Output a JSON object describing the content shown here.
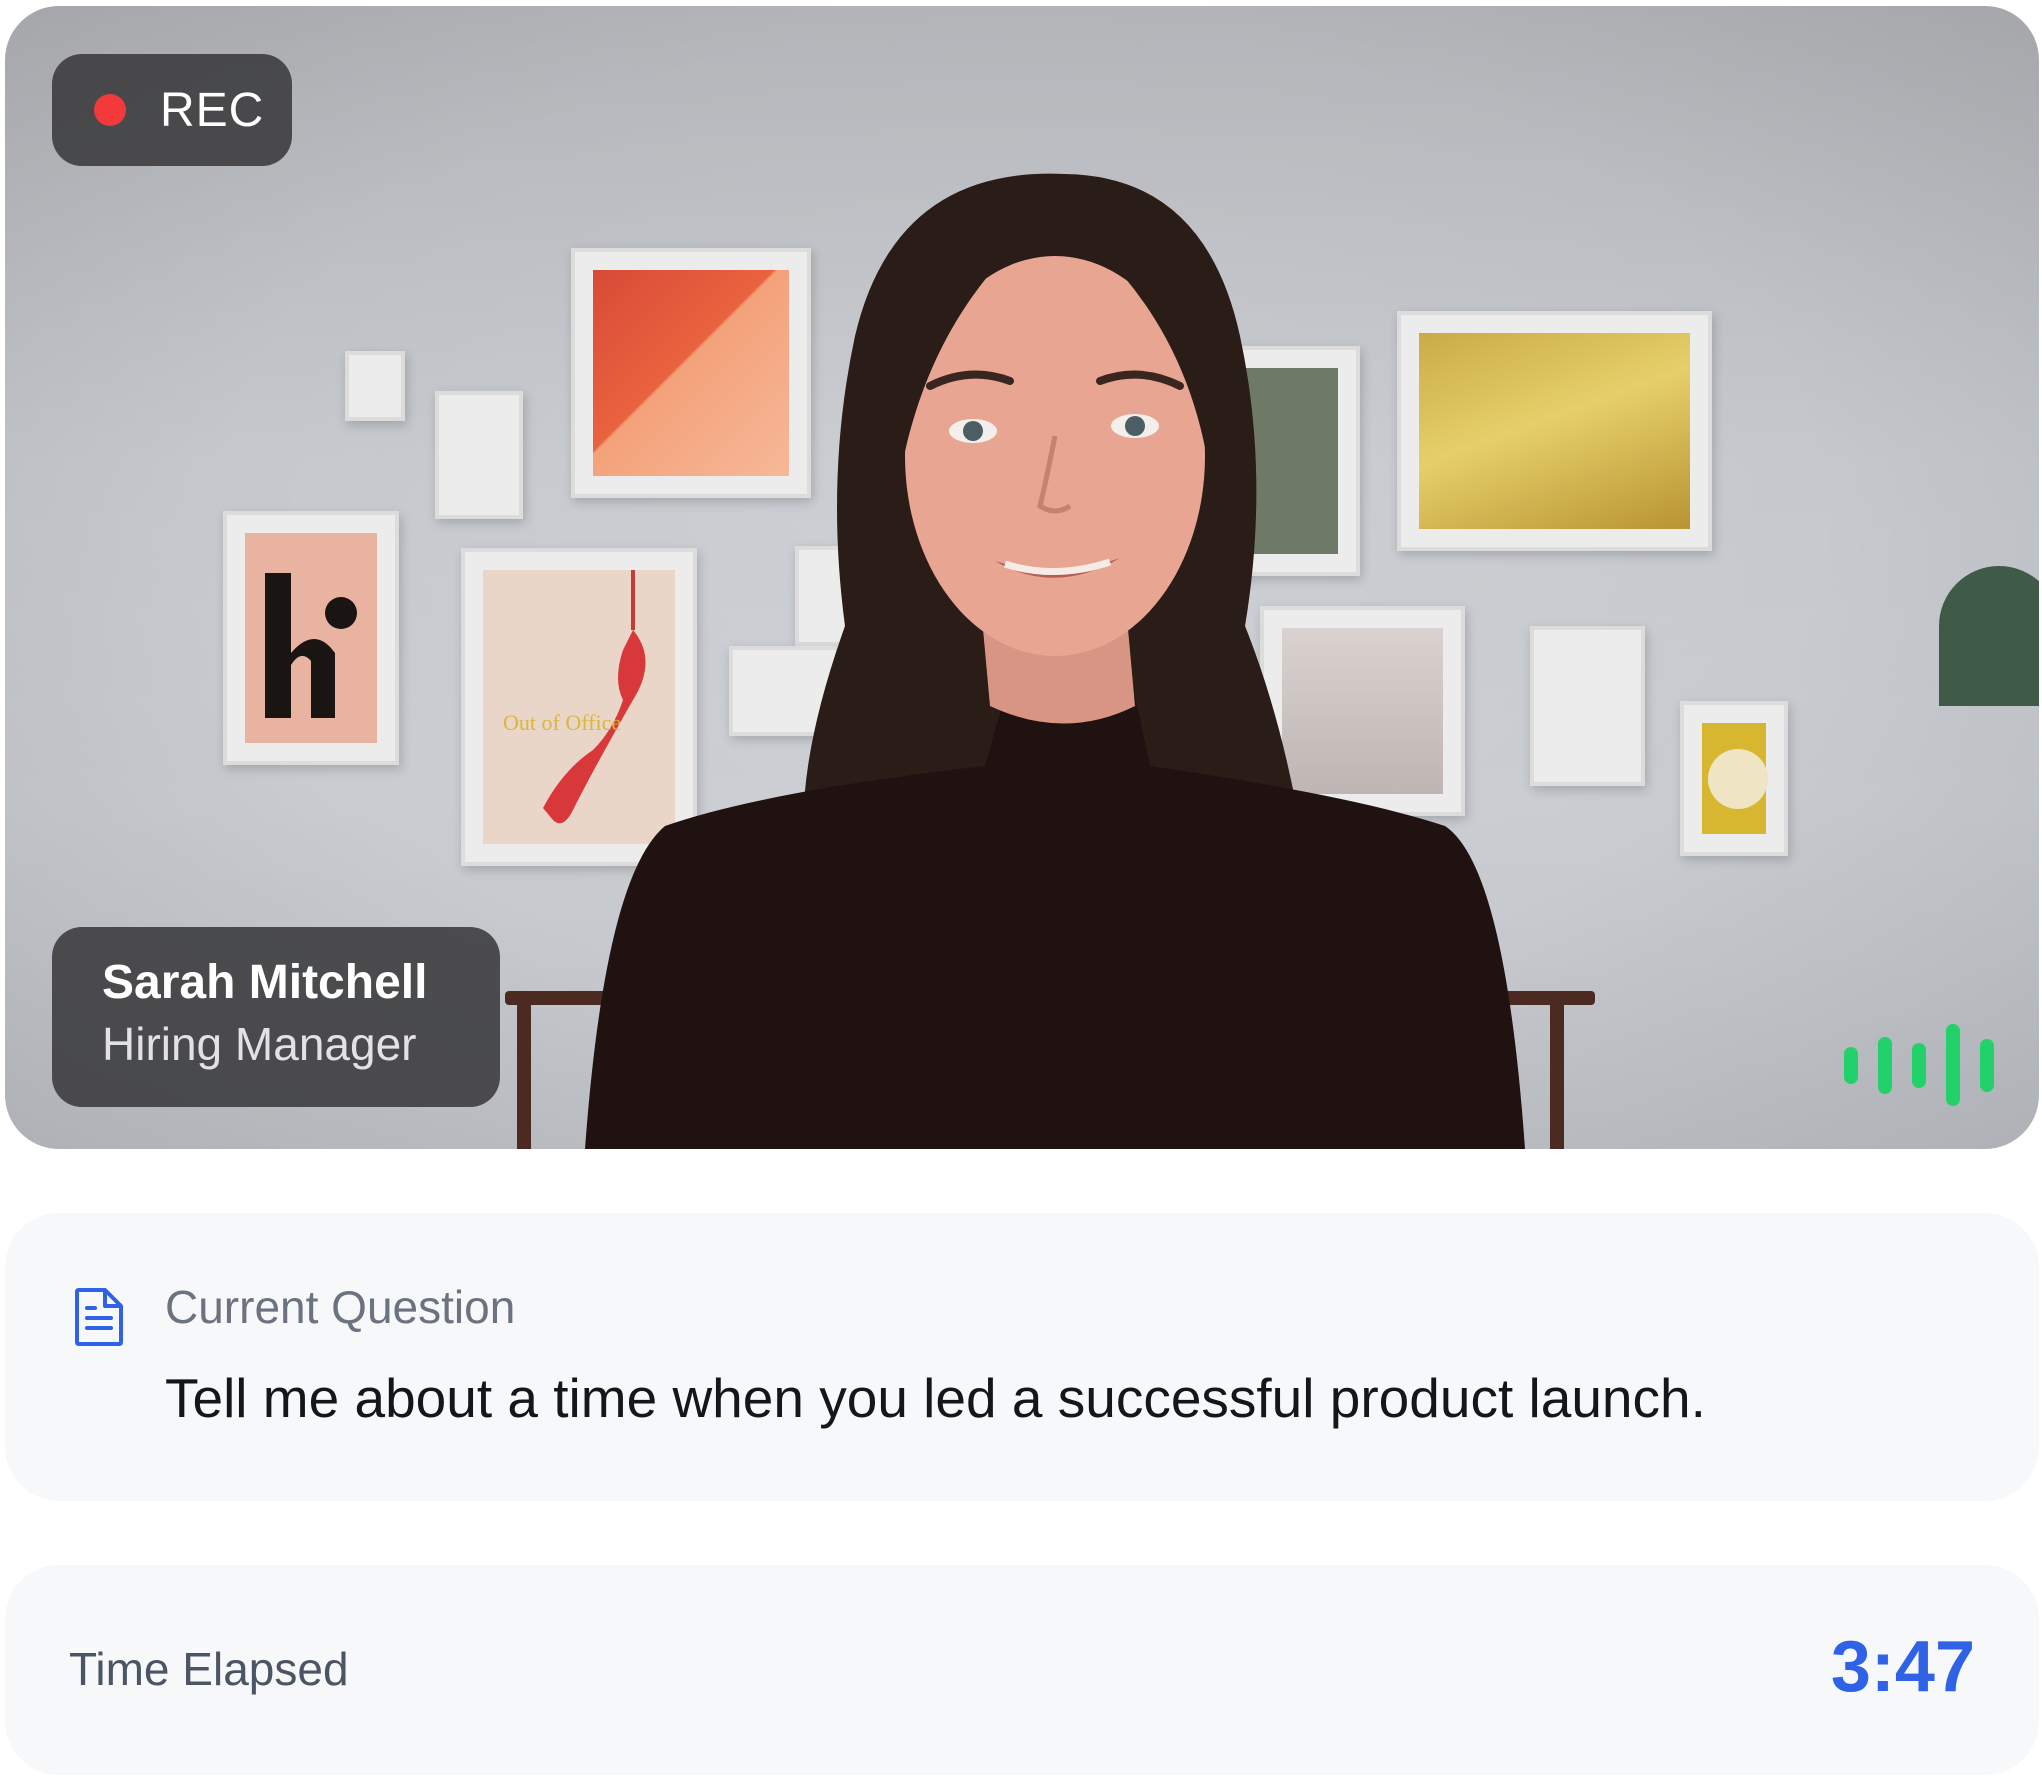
{
  "recording": {
    "label": "REC",
    "indicator_color": "#f23a3a"
  },
  "participant": {
    "name": "Sarah Mitchell",
    "role": "Hiring Manager"
  },
  "audio_level": {
    "icon": "audio-level-icon",
    "color": "#22d16a",
    "levels": [
      0.45,
      0.7,
      0.55,
      1.0,
      0.65
    ]
  },
  "question": {
    "icon": "document-icon",
    "label": "Current Question",
    "text": "Tell me about a time when you led a successful product launch."
  },
  "timer": {
    "label": "Time Elapsed",
    "value": "3:47",
    "accent_color": "#2f62e6"
  }
}
